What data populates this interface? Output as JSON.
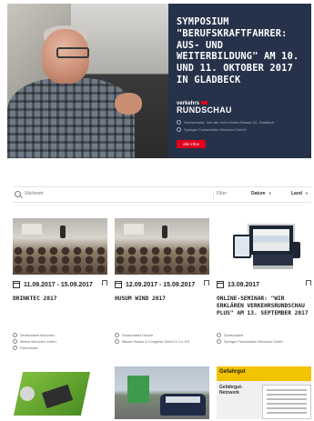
{
  "hero": {
    "kicker": "",
    "title": "SYMPOSIUM \"BERUFSKRAFTFAHRER: AUS- UND WEITERBILDUNG\" AM 10. UND 11. OKTOBER 2017 IN GLADBECK",
    "brand_top": "verkehrs",
    "brand_bottom": "RUNDSCHAU",
    "info_location": "Deutschland, Von-der-Vohr-Hofes-Strasse 22, Gladbeck",
    "info_organizer": "Springer Fachmedien München GmbH",
    "button": "alle infos"
  },
  "filter": {
    "search_placeholder": "Stichwort",
    "filter_label": "Filter",
    "sort_date": "Datum",
    "sort_country": "Land"
  },
  "cards": [
    {
      "date": "11.09.2017 - 15.09.2017",
      "title": "DRINKTEC 2017",
      "meta": [
        "Deutschland München",
        "Messe München GmbH",
        "Fachmesse"
      ]
    },
    {
      "date": "12.09.2017 - 15.09.2017",
      "title": "HUSUM WIND 2017",
      "meta": [
        "Deutschland Husum",
        "Messe Husum & Congress GmbH & Co. KG"
      ]
    },
    {
      "date": "13.09.2017",
      "title": "ONLINE-SEMINAR: \"WIR ERKLÄREN VERKEHRSRUNDSCHAU PLUS\" AM 13. SEPTEMBER 2017",
      "meta": [
        "Deutschland",
        "Springer Fachmedien München GmbH"
      ]
    }
  ],
  "bottom": {
    "third_head": "Gefahrgut",
    "third_sub": "Gefahrgut-Netzwerk"
  },
  "colors": {
    "hero_panel": "#26324a",
    "accent_red": "#e2001a"
  }
}
